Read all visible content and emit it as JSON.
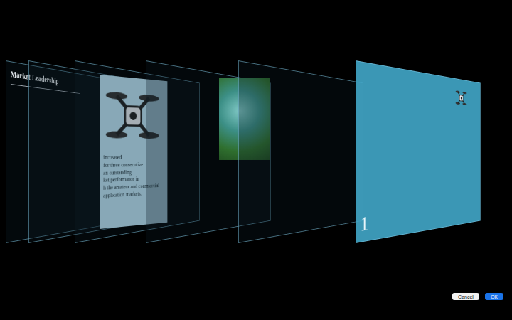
{
  "title": "Market Leadership",
  "card": {
    "lines": [
      "increased",
      "for three consecutive",
      "an outstanding",
      "ket performance in",
      "h the amateur and commercial",
      "application markets."
    ]
  },
  "layers": [
    {
      "kind": "title"
    },
    {
      "kind": "frame"
    },
    {
      "kind": "frame"
    },
    {
      "kind": "frame"
    },
    {
      "kind": "frame"
    },
    {
      "kind": "slide"
    }
  ],
  "slide_number": "1",
  "buttons": [
    {
      "label": "Cancel",
      "primary": false
    },
    {
      "label": "OK",
      "primary": true
    }
  ]
}
